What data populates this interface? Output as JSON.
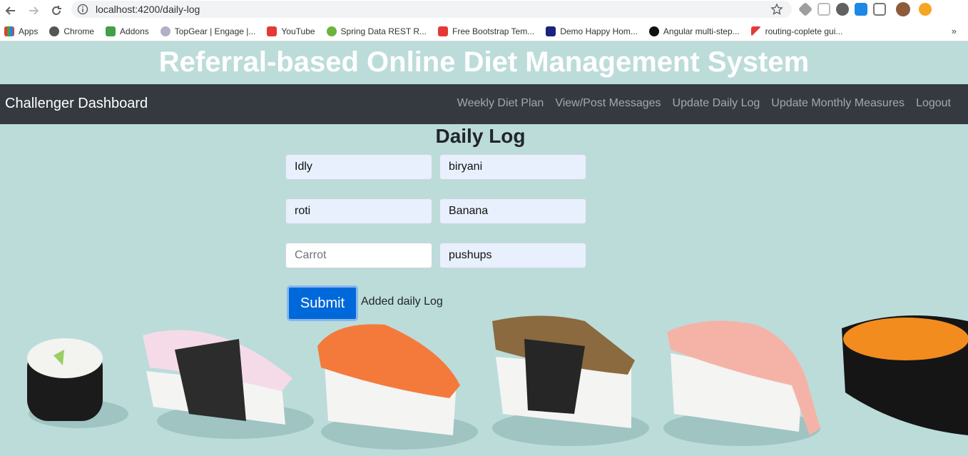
{
  "browser": {
    "url": "localhost:4200/daily-log",
    "bookmarks": [
      "Apps",
      "Chrome",
      "Addons",
      "TopGear | Engage |...",
      "YouTube",
      "Spring Data REST R...",
      "Free Bootstrap Tem...",
      "Demo Happy Hom...",
      "Angular multi-step...",
      "routing-coplete gui..."
    ],
    "more": "»"
  },
  "site": {
    "title": "Referral-based Online Diet Management System"
  },
  "navbar": {
    "brand": "Challenger Dashboard",
    "links": [
      "Weekly Diet Plan",
      "View/Post Messages",
      "Update Daily Log",
      "Update Monthly Measures",
      "Logout"
    ]
  },
  "form": {
    "title": "Daily Log",
    "fields": [
      {
        "value": "Idly",
        "placeholder": ""
      },
      {
        "value": "biryani",
        "placeholder": ""
      },
      {
        "value": "roti",
        "placeholder": ""
      },
      {
        "value": "Banana",
        "placeholder": ""
      },
      {
        "value": "",
        "placeholder": "Carrot"
      },
      {
        "value": "pushups",
        "placeholder": ""
      }
    ],
    "submit_label": "Submit",
    "status": "Added daily Log"
  },
  "colors": {
    "background": "#bcdcda",
    "navbar": "#343a40",
    "button": "#0069d9",
    "autofill": "#e8f0fe"
  }
}
